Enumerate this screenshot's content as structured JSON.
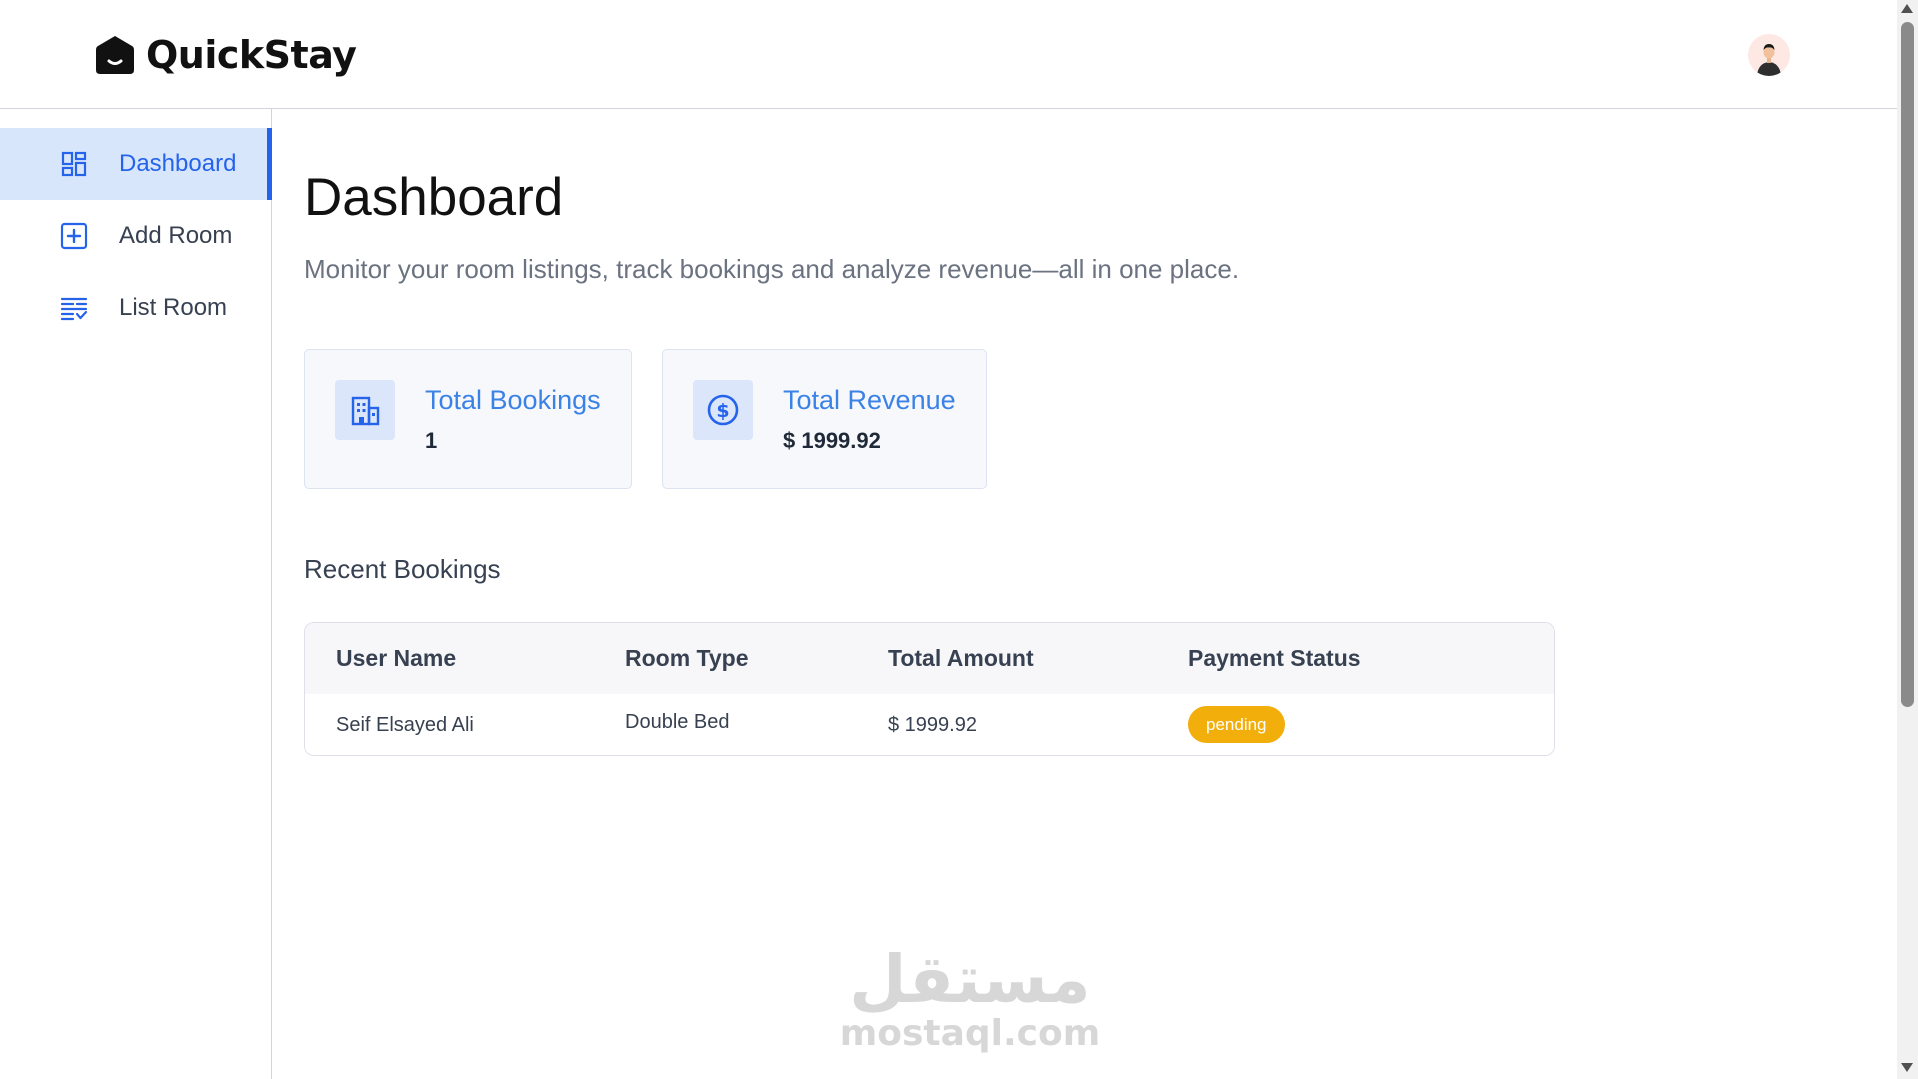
{
  "brand": {
    "name": "QuickStay"
  },
  "sidebar": {
    "items": [
      {
        "label": "Dashboard",
        "icon": "dashboard-grid-icon",
        "active": true
      },
      {
        "label": "Add Room",
        "icon": "plus-square-icon",
        "active": false
      },
      {
        "label": "List Room",
        "icon": "list-check-icon",
        "active": false
      }
    ]
  },
  "main": {
    "title": "Dashboard",
    "subtitle": "Monitor your room listings, track bookings and analyze revenue—all in one place."
  },
  "stats": [
    {
      "label": "Total Bookings",
      "value": "1",
      "icon": "building-icon"
    },
    {
      "label": "Total Revenue",
      "value": "$ 1999.92",
      "icon": "dollar-circle-icon"
    }
  ],
  "recent": {
    "title": "Recent Bookings",
    "columns": [
      "User Name",
      "Room Type",
      "Total Amount",
      "Payment Status"
    ],
    "rows": [
      {
        "user": "Seif Elsayed Ali",
        "room": "Double Bed",
        "amount": "$ 1999.92",
        "status": "pending"
      }
    ]
  },
  "colors": {
    "accent": "#2563eb",
    "active_bg": "#d8e6fc",
    "pending": "#f2ae0a"
  },
  "watermark": {
    "arabic": "مستقل",
    "latin": "mostaql.com"
  }
}
